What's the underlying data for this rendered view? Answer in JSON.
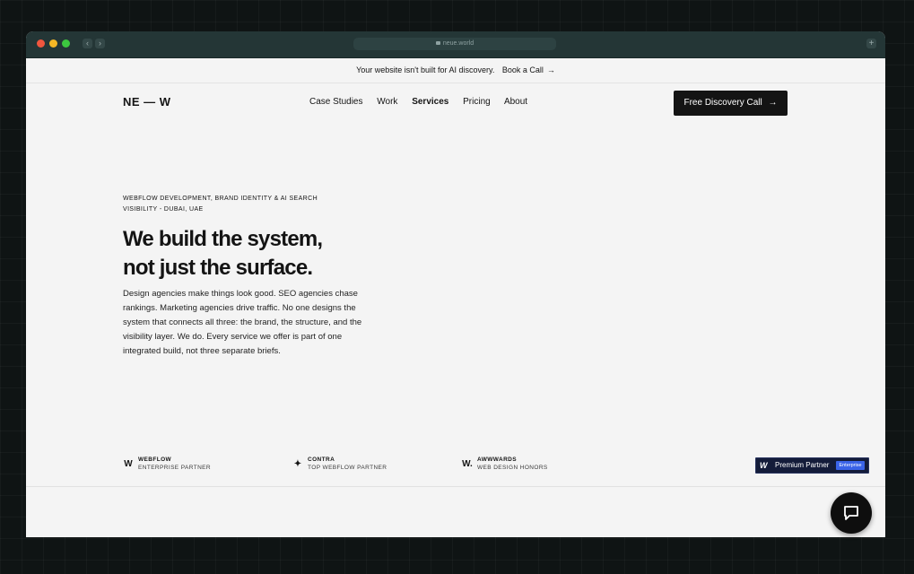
{
  "browser": {
    "url": "neue.world",
    "back_icon": "chevron-left-icon",
    "forward_icon": "chevron-right-icon",
    "new_tab_icon": "plus-icon"
  },
  "announcement": {
    "text": "Your website isn't built for AI discovery.",
    "cta": "Book a Call",
    "arrow": "→"
  },
  "nav": {
    "logo": "NE — W",
    "items": [
      {
        "label": "Case Studies"
      },
      {
        "label": "Work"
      },
      {
        "label": "Services",
        "active": true
      },
      {
        "label": "Pricing"
      },
      {
        "label": "About"
      }
    ],
    "cta": "Free Discovery Call",
    "cta_arrow": "→"
  },
  "hero": {
    "eyebrow": "WEBFLOW DEVELOPMENT, BRAND IDENTITY & AI SEARCH VISIBILITY - DUBAI, UAE",
    "headline_line1": "We build the system,",
    "headline_line2": "not just the surface.",
    "body": "Design agencies make things look good. SEO agencies chase rankings. Marketing agencies drive traffic. No one designs the system that connects all three: the brand, the structure, and the visibility layer. We do. Every service we offer is part of one integrated build, not three separate briefs."
  },
  "partners": [
    {
      "icon": "webflow-icon",
      "glyph": "W",
      "name": "WEBFLOW",
      "sub": "ENTERPRISE PARTNER"
    },
    {
      "icon": "contra-icon",
      "glyph": "✦",
      "name": "CONTRA",
      "sub": "TOP WEBFLOW PARTNER"
    },
    {
      "icon": "awwwards-icon",
      "glyph": "W.",
      "name": "AWWWARDS",
      "sub": "WEB DESIGN HONORS"
    }
  ],
  "premium_badge": {
    "label": "Premium Partner",
    "tier": "Enterprise"
  },
  "chat": {
    "icon": "chat-bubble-icon"
  },
  "colors": {
    "page_bg": "#f4f4f4",
    "text": "#141414",
    "button_bg": "#141414",
    "badge_bg": "#141c3a",
    "badge_accent": "#3a63e8",
    "chrome_bg": "#243636"
  }
}
